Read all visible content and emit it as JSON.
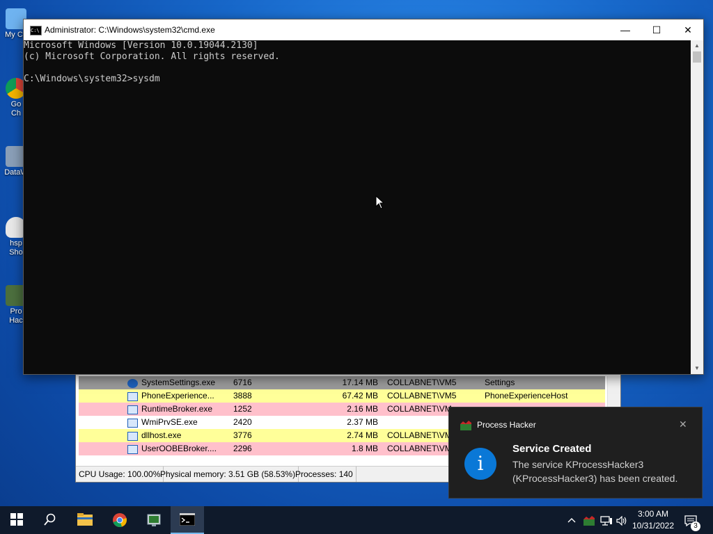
{
  "desktop": {
    "icons": [
      {
        "label_1": "My Co",
        "label_2": ""
      },
      {
        "label_1": "Go",
        "label_2": "Ch"
      },
      {
        "label_1": "DataW",
        "label_2": ""
      },
      {
        "label_1": "hsp",
        "label_2": "Sho"
      },
      {
        "label_1": "Pro",
        "label_2": "Hac"
      }
    ]
  },
  "cmd": {
    "title": "Administrator: C:\\Windows\\system32\\cmd.exe",
    "icon_text": "C:\\",
    "buttons": {
      "minimize": "—",
      "maximize": "☐",
      "close": "✕"
    },
    "lines": [
      "Microsoft Windows [Version 10.0.19044.2130]",
      "(c) Microsoft Corporation. All rights reserved.",
      "",
      "C:\\Windows\\system32>sysdm"
    ]
  },
  "process_hacker": {
    "rows": [
      {
        "name": "SystemSettings.exe",
        "pid": "6716",
        "mem": "17.14 MB",
        "user": "COLLABNET\\VM5",
        "desc": "Settings",
        "bg": "#9a9a9a",
        "icon": "gear-icon"
      },
      {
        "name": "PhoneExperience...",
        "pid": "3888",
        "mem": "67.42 MB",
        "user": "COLLABNET\\VM5",
        "desc": "PhoneExperienceHost",
        "bg": "#ffff99",
        "icon": "app-icon"
      },
      {
        "name": "RuntimeBroker.exe",
        "pid": "1252",
        "mem": "2.16 MB",
        "user": "COLLABNET\\VM",
        "desc": "",
        "bg": "#ffc0cb",
        "icon": "app-icon"
      },
      {
        "name": "WmiPrvSE.exe",
        "pid": "2420",
        "mem": "2.37 MB",
        "user": "",
        "desc": "",
        "bg": "#ffffff",
        "icon": "app-icon"
      },
      {
        "name": "dllhost.exe",
        "pid": "3776",
        "mem": "2.74 MB",
        "user": "COLLABNET\\VM",
        "desc": "",
        "bg": "#ffff99",
        "icon": "app-icon"
      },
      {
        "name": "UserOOBEBroker....",
        "pid": "2296",
        "mem": "1.8 MB",
        "user": "COLLABNET\\VM",
        "desc": "",
        "bg": "#ffc0cb",
        "icon": "app-icon"
      }
    ],
    "status": {
      "cpu": "CPU Usage: 100.00%",
      "memory": "Physical memory: 3.51 GB (58.53%)",
      "processes": "Processes: 140"
    }
  },
  "toast": {
    "app_name": "Process Hacker",
    "close": "✕",
    "icon_text": "i",
    "title": "Service Created",
    "body": "The service KProcessHacker3 (KProcessHacker3) has been created."
  },
  "taskbar": {
    "time": "3:00 AM",
    "date": "10/31/2022",
    "notification_count": "3"
  }
}
